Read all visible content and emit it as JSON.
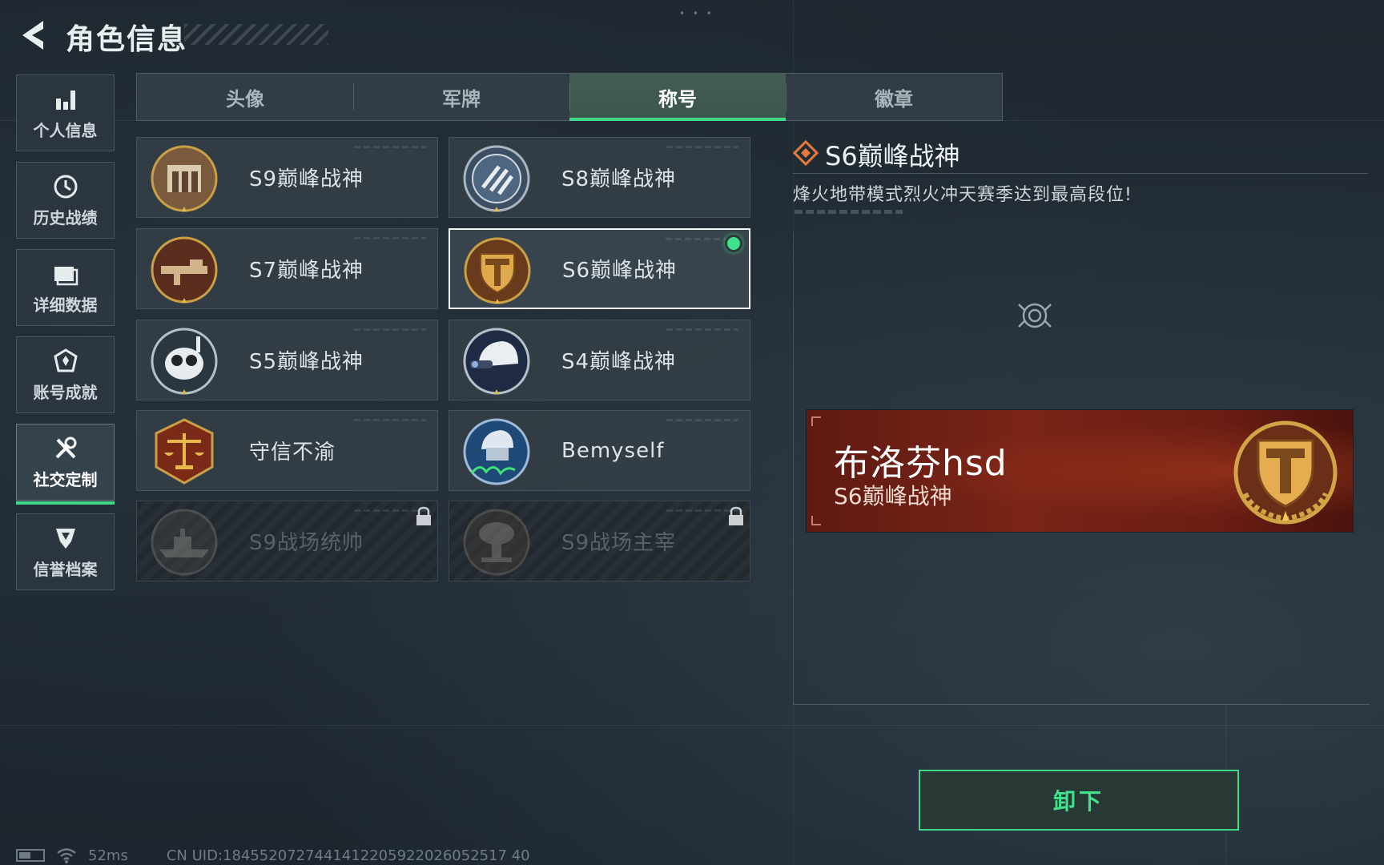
{
  "header": {
    "title": "角色信息"
  },
  "nav": [
    {
      "label": "个人信息",
      "icon": "bar-chart-icon"
    },
    {
      "label": "历史战绩",
      "icon": "history-clock-icon"
    },
    {
      "label": "详细数据",
      "icon": "folder-icon"
    },
    {
      "label": "账号成就",
      "icon": "achievement-icon"
    },
    {
      "label": "社交定制",
      "icon": "tools-icon",
      "active": true
    },
    {
      "label": "信誉档案",
      "icon": "credit-shield-icon"
    }
  ],
  "tabs": [
    {
      "label": "头像"
    },
    {
      "label": "军牌"
    },
    {
      "label": "称号",
      "active": true
    },
    {
      "label": "徽章"
    }
  ],
  "titles": [
    {
      "name": "S9巅峰战神",
      "badge": "fortress-badge"
    },
    {
      "name": "S8巅峰战神",
      "badge": "stripes-badge"
    },
    {
      "name": "S7巅峰战神",
      "badge": "rifle-badge"
    },
    {
      "name": "S6巅峰战神",
      "badge": "t-shield-badge",
      "selected": true,
      "equipped": true
    },
    {
      "name": "S5巅峰战神",
      "badge": "mask-badge"
    },
    {
      "name": "S4巅峰战神",
      "badge": "helmet-badge"
    },
    {
      "name": "守信不渝",
      "badge": "scales-badge"
    },
    {
      "name": "Bemyself",
      "badge": "soldier-signature-badge"
    },
    {
      "name": "S9战场统帅",
      "badge": "warship-badge",
      "locked": true
    },
    {
      "name": "S9战场主宰",
      "badge": "mushroom-cloud-badge",
      "locked": true
    }
  ],
  "detail": {
    "title": "S6巅峰战神",
    "description": "烽火地带模式烈火冲天赛季达到最高段位!"
  },
  "banner": {
    "player_name": "布洛芬hsd",
    "title": "S6巅峰战神"
  },
  "action": {
    "unequip_label": "卸下"
  },
  "status": {
    "ping": "52ms",
    "uid": "CN UID:1845520727441412205922026052517 40"
  },
  "colors": {
    "accent_green": "#3fd98a",
    "banner_red": "#7a2417",
    "badge_gold": "#c9a045"
  }
}
